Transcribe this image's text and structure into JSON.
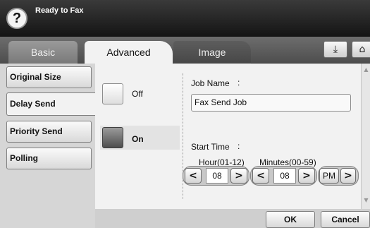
{
  "titlebar": {
    "help_glyph": "?",
    "title": "Ready to Fax"
  },
  "tabs": [
    {
      "label": "Basic",
      "active": false
    },
    {
      "label": "Advanced",
      "active": true
    },
    {
      "label": "Image",
      "active": false
    }
  ],
  "top_icons": [
    {
      "icon": "tray-icon",
      "glyph": "⤓"
    },
    {
      "icon": "home-icon",
      "glyph": "⌂"
    }
  ],
  "menu": [
    {
      "label": "Original Size",
      "active": false
    },
    {
      "label": "Delay Send",
      "active": true
    },
    {
      "label": "Priority Send",
      "active": false
    },
    {
      "label": "Polling",
      "active": false
    }
  ],
  "delay_send": {
    "off_label": "Off",
    "on_label": "On",
    "selected": "On"
  },
  "job_name": {
    "label": "Job Name",
    "colon": ":",
    "value": "Fax Send Job"
  },
  "start_time": {
    "label": "Start Time",
    "colon": ":",
    "hour_label": "Hour(01-12)",
    "hour_value": "08",
    "minutes_label": "Minutes(00-59)",
    "minutes_value": "08",
    "ampm": "PM",
    "left_glyph": "<",
    "right_glyph": ">"
  },
  "scroll": {
    "up_glyph": "▲",
    "down_glyph": "▼"
  },
  "footer": {
    "ok_label": "OK",
    "cancel_label": "Cancel"
  },
  "colors": {
    "titlebar": "#1f1f1f",
    "panel": "#f2f2f2",
    "background": "#d6d6d6",
    "on_box": "#5a5a5a"
  }
}
